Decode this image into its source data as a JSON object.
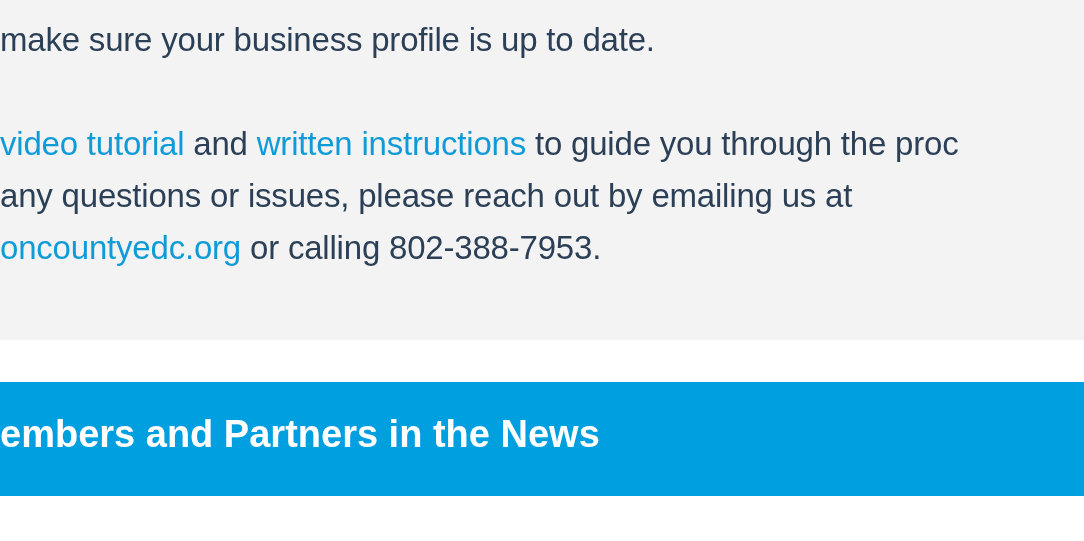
{
  "intro": {
    "paragraphs": [
      [
        {
          "text": "make sure your business profile is up to date."
        }
      ],
      [
        {
          "text": "video tutorial",
          "link": true
        },
        {
          "text": " and "
        },
        {
          "text": "written instructions",
          "link": true
        },
        {
          "text": " to guide you through the proc"
        }
      ],
      [
        {
          "text": "any questions or issues, please reach out by emailing us at"
        }
      ],
      [
        {
          "text": "oncountyedc.org",
          "link": true
        },
        {
          "text": " or calling 802-388-7953."
        }
      ]
    ]
  },
  "section_banner": {
    "title": "embers and Partners in the News"
  }
}
